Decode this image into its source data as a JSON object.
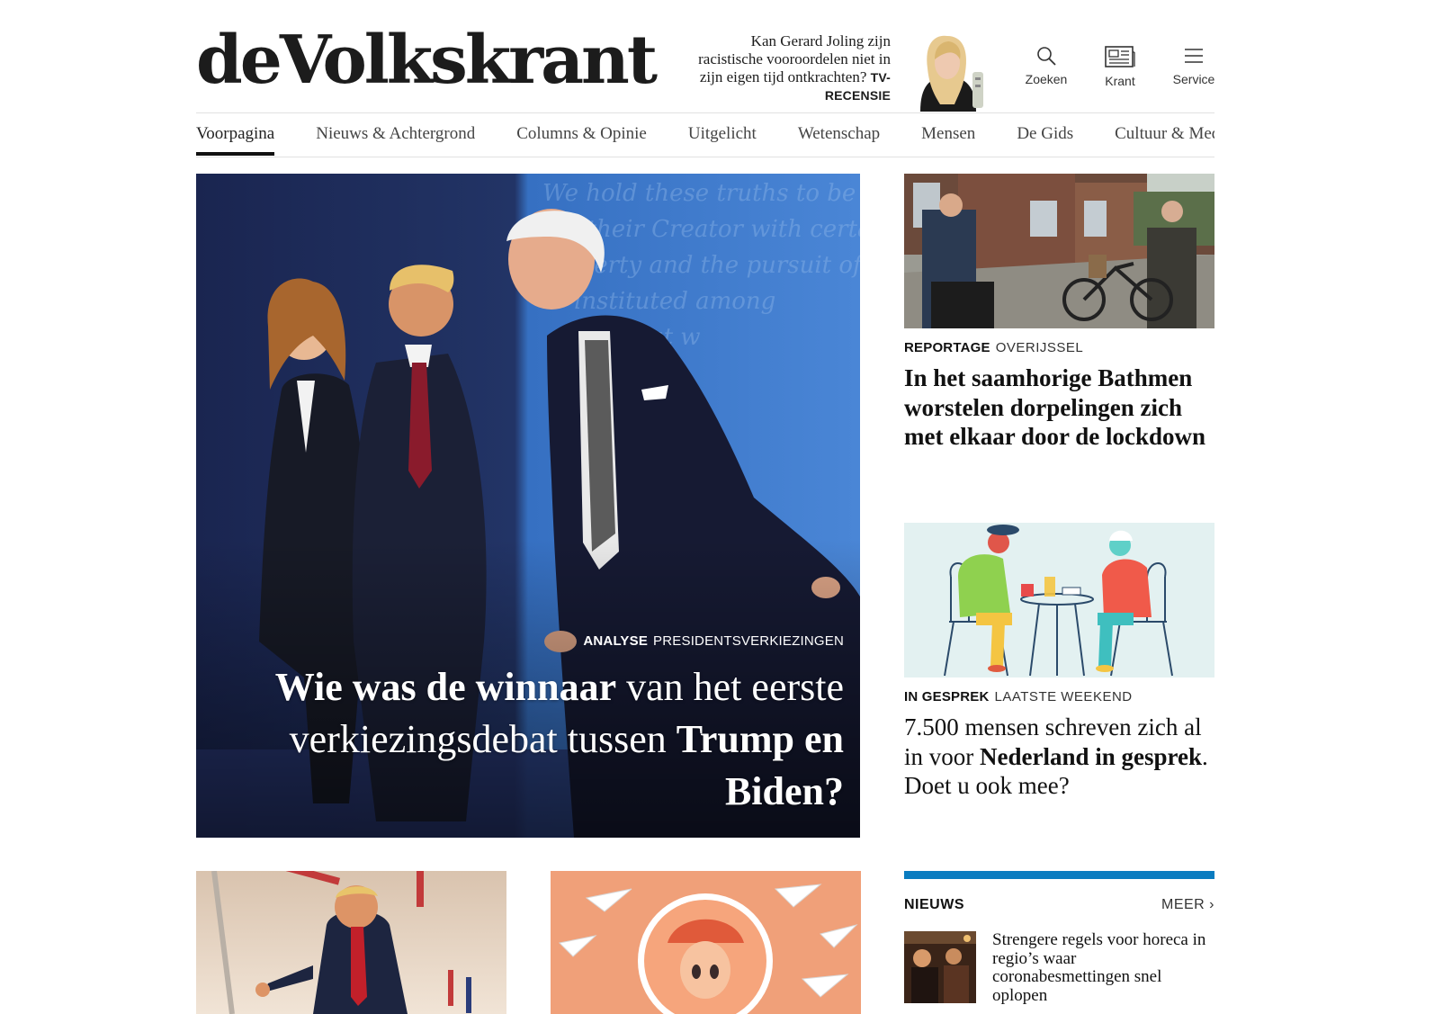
{
  "header": {
    "logo_text": "deVolkskrant",
    "teaser": {
      "text": "Kan Gerard Joling zijn racistische vooroordelen niet in zijn eigen tijd ontkrachten?",
      "tag": "TV-RECENSIE"
    },
    "buttons": {
      "search_label": "Zoeken",
      "paper_label": "Krant",
      "service_label": "Service"
    }
  },
  "nav": {
    "items": [
      {
        "label": "Voorpagina",
        "active": true
      },
      {
        "label": "Nieuws & Achtergrond"
      },
      {
        "label": "Columns & Opinie"
      },
      {
        "label": "Uitgelicht"
      },
      {
        "label": "Wetenschap"
      },
      {
        "label": "Mensen"
      },
      {
        "label": "De Gids"
      },
      {
        "label": "Cultuur & Media"
      }
    ]
  },
  "hero": {
    "kicker_label": "ANALYSE",
    "kicker_topic": "PRESIDENTSVERKIEZINGEN",
    "title_part1": "Wie was de winnaar",
    "title_part2": " van het eerste verkiezingsdebat tussen ",
    "title_part3": "Trump en Biden?"
  },
  "side_articles": [
    {
      "kicker_label": "REPORTAGE",
      "kicker_topic": "OVERIJSSEL",
      "title": "In het saamhorige Bathmen worstelen dorpelingen zich met elkaar door de lockdown"
    },
    {
      "kicker_label": "IN GESPREK",
      "kicker_topic": "LAATSTE WEEKEND",
      "title_part1": "7.500 mensen schreven zich al in voor ",
      "title_part2": "Nederland in gesprek",
      "title_part3": ". Doet u ook mee?"
    }
  ],
  "news": {
    "heading": "NIEUWS",
    "more_label": "MEER",
    "items": [
      {
        "title": "Strengere regels voor horeca in regio’s waar coronabesmettingen snel oplopen"
      }
    ]
  },
  "colors": {
    "news_accent": "#0a7cc0",
    "hero_bg_left": "#1d2a59",
    "hero_bg_right": "#3b76c9",
    "illustration_bg": "#e3f1f1",
    "tile_orange": "#f0a079"
  }
}
